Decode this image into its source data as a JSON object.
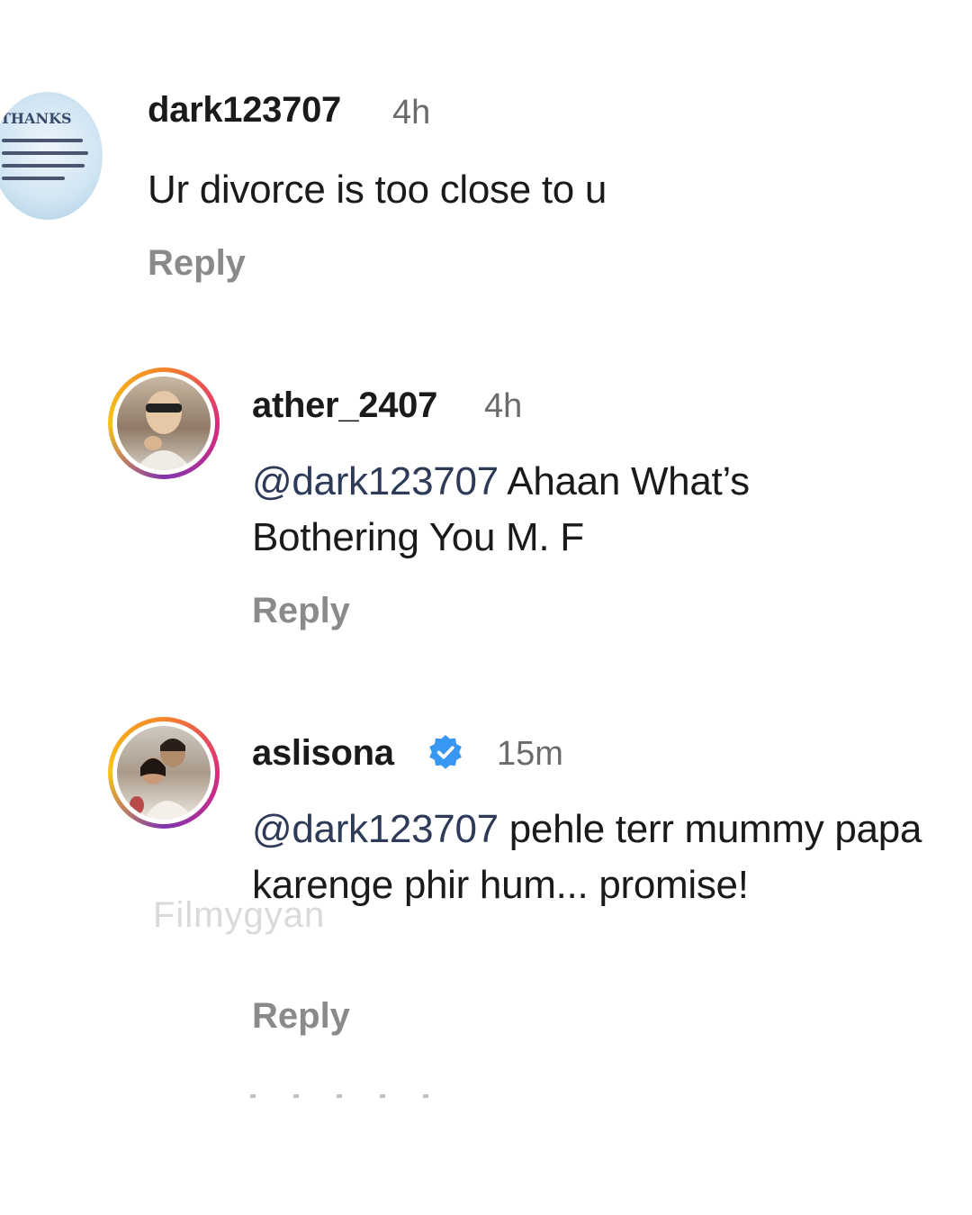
{
  "comments": [
    {
      "username": "dark123707",
      "time": "4h",
      "text": "Ur divorce is too close to u",
      "reply_label": "Reply",
      "avatar": {
        "icon": "thanks-note-avatar",
        "caption": "THANKS"
      }
    },
    {
      "username": "ather_2407",
      "time": "4h",
      "mention": "@dark123707",
      "text": " Ahaan What’s Bothering You M. F",
      "reply_label": "Reply",
      "avatar": {
        "icon": "user-photo-avatar"
      }
    },
    {
      "username": "aslisona",
      "verified": true,
      "time": "15m",
      "mention": "@dark123707",
      "text": " pehle terr mummy papa karenge phir hum... promise!",
      "reply_label": "Reply",
      "avatar": {
        "icon": "couple-photo-avatar"
      }
    }
  ],
  "watermark": "Filmygyan",
  "colors": {
    "verified_badge": "#3897f0",
    "story_ring": [
      "#f58529",
      "#dd2a7b",
      "#8134af",
      "#f5c518"
    ],
    "reply_text": "#8a8a8a"
  }
}
